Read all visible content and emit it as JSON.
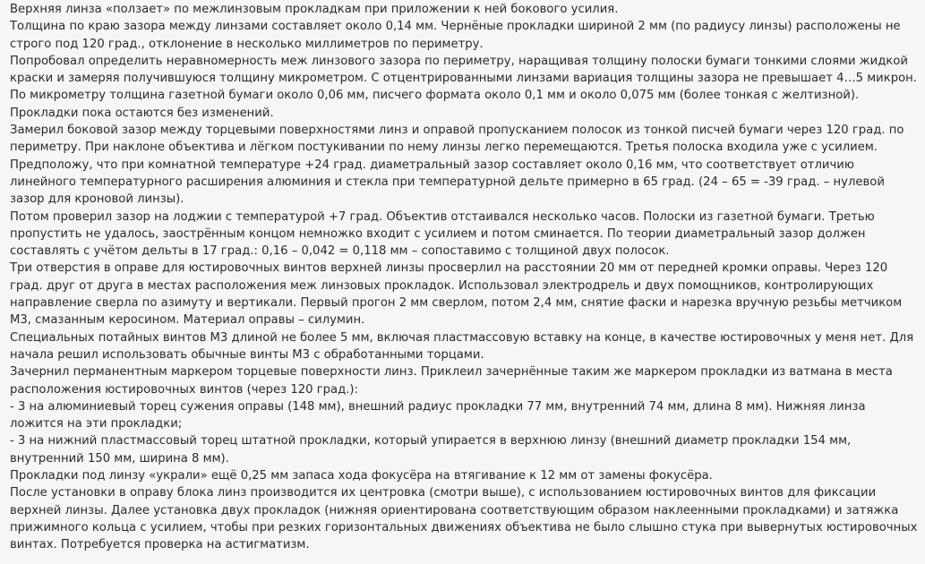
{
  "post": {
    "paragraphs": [
      "Верхняя линза «ползает» по межлинзовым прокладкам при приложении к ней бокового усилия.",
      "Толщина по краю зазора между линзами составляет около 0,14 мм. Чернёные прокладки шириной 2 мм (по радиусу линзы) расположены не строго под 120 град., отклонение в несколько миллиметров по периметру.",
      "Попробовал определить неравномерность меж линзового зазора по периметру, наращивая толщину полоски бумаги тонкими слоями жидкой краски и замеряя получившуюся толщину микрометром. С отцентрированными линзами вариация толщины зазора не превышает 4…5 микрон.",
      "По микрометру толщина газетной бумаги около 0,06 мм, писчего формата около 0,1 мм и около 0,075 мм (более тонкая с желтизной).",
      "Прокладки пока остаются без изменений.",
      "Замерил боковой зазор между торцевыми поверхностями линз и оправой пропусканием полосок из тонкой писчей бумаги через 120 град. по периметру. При наклоне объектива и лёгком постукивании по нему линзы легко перемещаются. Третья полоска входила уже с усилием.",
      "Предположу, что при комнатной температуре +24 град. диаметральный зазор составляет около 0,16 мм, что соответствует отличию линейного температурного расширения алюминия и стекла при температурной дельте примерно в 65 град. (24 – 65 = -39 град. – нулевой зазор для кроновой линзы).",
      "Потом проверил зазор на лоджии с температурой +7 град. Объектив отстаивался несколько часов. Полоски из газетной бумаги. Третью пропустить не удалось, заострённым концом немножко входит с усилием и потом сминается. По теории диаметральный зазор должен составлять с учётом дельты в 17 град.: 0,16 – 0,042 = 0,118 мм – сопоставимо с толщиной двух полосок.",
      "Три отверстия в оправе для юстировочных винтов верхней линзы просверлил на расстоянии 20 мм от передней кромки оправы. Через 120 град. друг от друга в местах расположения меж линзовых прокладок. Использовал электродрель и двух помощников, контролирующих направление сверла по азимуту и вертикали. Первый прогон 2 мм сверлом, потом 2,4 мм, снятие фаски и нарезка вручную резьбы метчиком М3, смазанным керосином. Материал оправы – силумин.",
      "Специальных потайных винтов М3 длиной не более 5 мм, включая пластмассовую вставку на конце, в качестве юстировочных у меня нет. Для начала решил использовать обычные винты М3 с обработанными торцами.",
      "Зачернил перманентным маркером торцевые поверхности линз. Приклеил зачернённые таким же маркером прокладки из ватмана в места расположения юстировочных винтов (через 120 град.):",
      "- 3 на алюминиевый торец сужения оправы (148 мм), внешний радиус прокладки 77 мм, внутренний 74 мм, длина 8 мм). Нижняя линза ложится на эти прокладки;",
      "- 3 на нижний пластмассовый торец штатной прокладки, который упирается в верхнюю линзу (внешний диаметр прокладки 154 мм, внутренний 150 мм, ширина 8 мм).",
      "Прокладки под линзу «украли» ещё 0,25 мм запаса хода фокусёра на втягивание к 12 мм от замены фокусёра.",
      "После установки в оправу блока линз производится их центровка (смотри выше), с использованием юстировочных винтов для фиксации верхней линзы. Далее установка двух прокладок (нижняя ориентирована соответствующим образом наклеенными прокладками) и затяжка прижимного кольца с усилием, чтобы при резких горизонтальных движениях объектива не было слышно стука при вывернутых юстировочных винтах. Потребуется проверка на астигматизм."
    ]
  }
}
